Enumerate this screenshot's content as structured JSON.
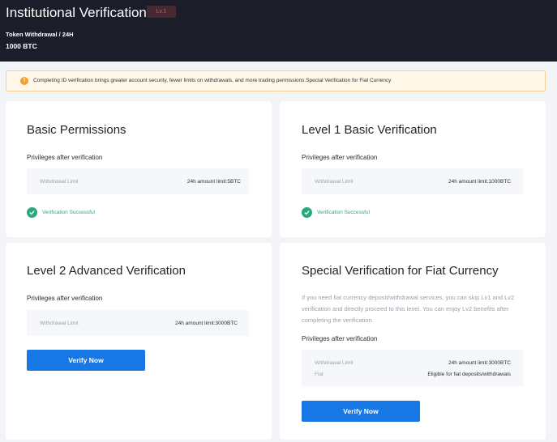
{
  "header": {
    "title": "Institutional Verification",
    "level_badge": "Lv.1",
    "token_withdrawal_label": "Token Withdrawal / 24H",
    "token_withdrawal_value": "1000 BTC"
  },
  "notice": {
    "text": "Completing ID verification brings greater account security, fewer limits on withdrawals, and more trading permissions.Special Verification for Fiat Currency",
    "icon": "info-icon"
  },
  "cards": {
    "basic": {
      "title": "Basic Permissions",
      "privileges_label": "Privileges after verification",
      "rows": [
        {
          "label": "Withdrawal Limit",
          "value": "24h amount limit:5BTC"
        }
      ],
      "status": "Verification Successful"
    },
    "level1": {
      "title": "Level 1 Basic Verification",
      "privileges_label": "Privileges after verification",
      "rows": [
        {
          "label": "Withdrawal Limit",
          "value": "24h amount limit:1000BTC"
        }
      ],
      "status": "Verification Successful"
    },
    "level2": {
      "title": "Level 2 Advanced Verification",
      "privileges_label": "Privileges after verification",
      "rows": [
        {
          "label": "Withdrawal Limit",
          "value": "24h amount limit:3000BTC"
        }
      ],
      "button": "Verify Now"
    },
    "fiat": {
      "title": "Special Verification for Fiat Currency",
      "description": "If you need fiat currency deposit/withdrawal services, you can skip Lv1 and Lv2 verification and directly proceed to this level. You can enjoy Lv2 benefits after completing the verification.",
      "privileges_label": "Privileges after verification",
      "rows": [
        {
          "label": "Withdrawal Limit",
          "value": "24h amount limit:3000BTC"
        },
        {
          "label": "Fiat",
          "value": "Eligible for fiat deposits/withdrawals"
        }
      ],
      "button": "Verify Now"
    }
  },
  "colors": {
    "header_bg": "#1b1d29",
    "accent_blue": "#1677e5",
    "success_green": "#2aa87a",
    "badge_red": "#d95766",
    "notice_bg": "#fff7e8"
  }
}
